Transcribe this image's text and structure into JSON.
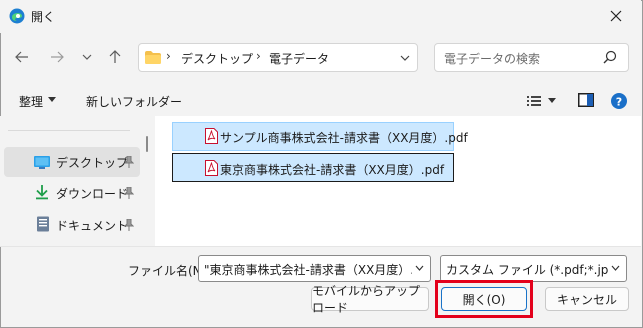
{
  "window": {
    "title": "開く"
  },
  "address_bar": {
    "segments": [
      "デスクトップ",
      "電子データ"
    ],
    "separator": "›"
  },
  "search": {
    "placeholder": "電子データの検索"
  },
  "toolbar": {
    "organize": "整理",
    "new_folder": "新しいフォルダー"
  },
  "nav_pane": {
    "items": [
      {
        "label": "デスクトップ",
        "icon": "desktop-icon",
        "selected": true
      },
      {
        "label": "ダウンロード",
        "icon": "download-icon",
        "selected": false
      },
      {
        "label": "ドキュメント",
        "icon": "document-icon",
        "selected": false
      }
    ]
  },
  "files": [
    {
      "name": "サンプル商事株式会社-請求書（XX月度）.pdf",
      "icon": "pdf-icon"
    },
    {
      "name": "東京商事株式会社-請求書（XX月度）.pdf",
      "icon": "pdf-icon"
    }
  ],
  "filename": {
    "label": "ファイル名(N):",
    "value": "\"東京商事株式会社-請求書（XX月度）.pdf\" \"サンプル商事株式会社-請求書（XX月度）.pdf\""
  },
  "filetype": {
    "value": "カスタム ファイル (*.pdf;*.jpg;*.jpeg;*.png)"
  },
  "buttons": {
    "upload": "モバイルからアップロード",
    "open": "開く(O)",
    "cancel": "キャンセル"
  },
  "colors": {
    "accent": "#1a73c8",
    "highlight": "#e3001b",
    "selection": "#cce8ff"
  }
}
